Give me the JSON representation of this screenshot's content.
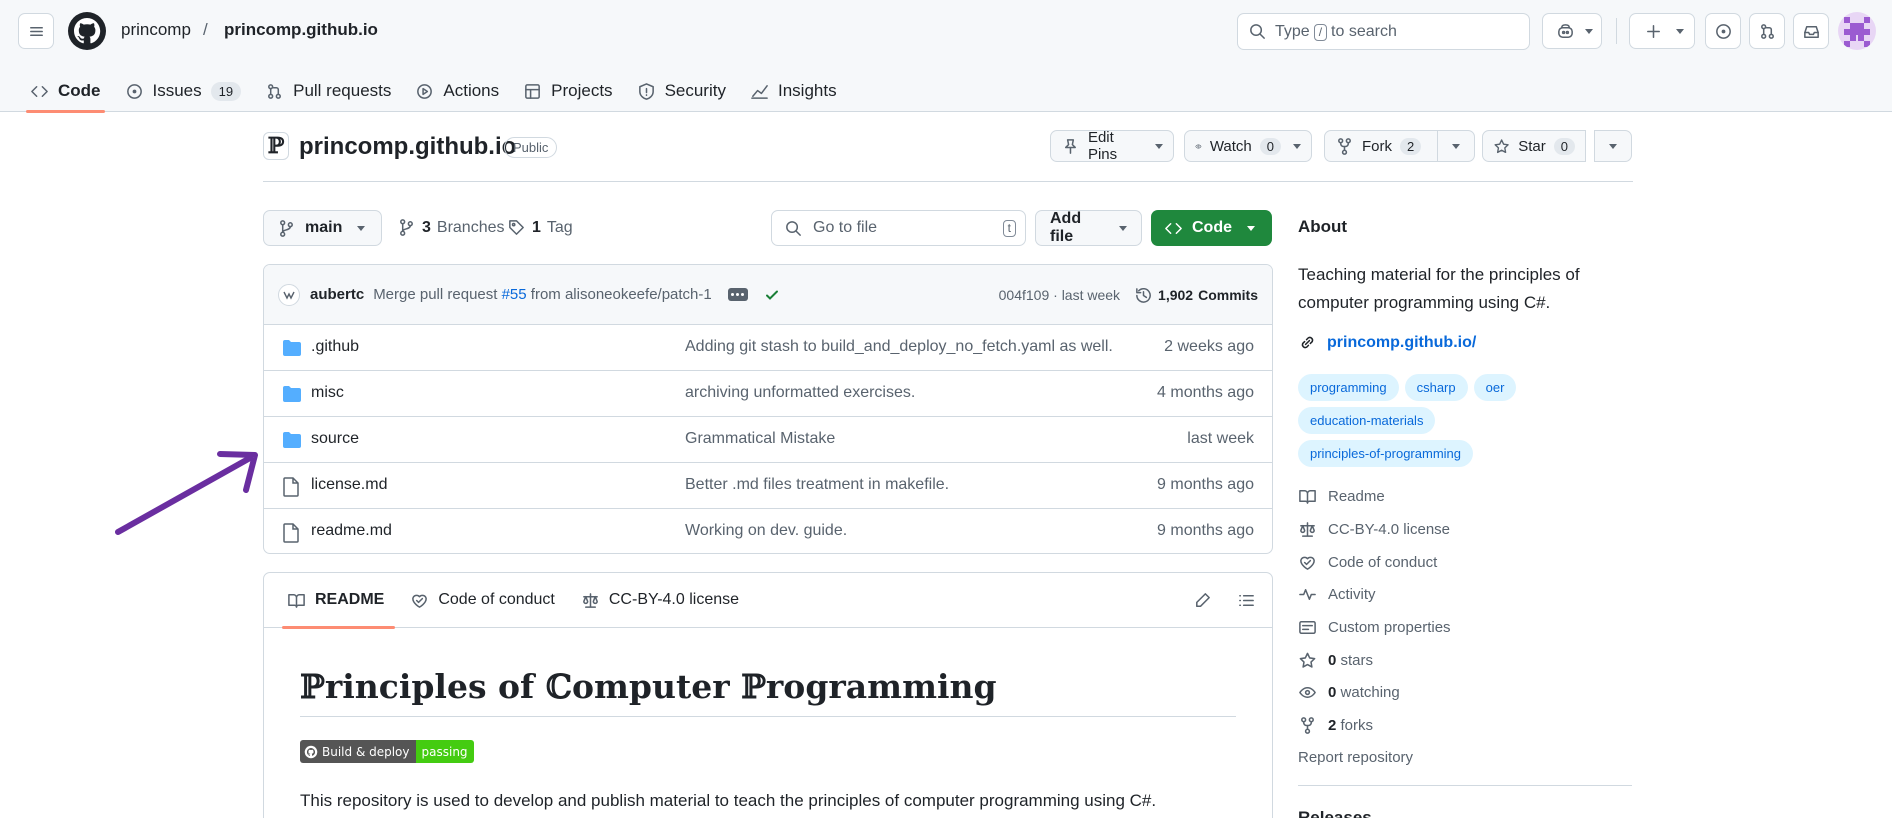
{
  "header": {
    "owner": "princomp",
    "separator": "/",
    "repo": "princomp.github.io",
    "search_prefix": "Type",
    "search_key": "/",
    "search_suffix": "to search"
  },
  "tabs": [
    {
      "label": "Code",
      "icon": "code-icon"
    },
    {
      "label": "Issues",
      "icon": "issue-icon",
      "count": "19"
    },
    {
      "label": "Pull requests",
      "icon": "pull-request-icon"
    },
    {
      "label": "Actions",
      "icon": "play-icon"
    },
    {
      "label": "Projects",
      "icon": "table-icon"
    },
    {
      "label": "Security",
      "icon": "shield-icon"
    },
    {
      "label": "Insights",
      "icon": "graph-icon"
    }
  ],
  "repo": {
    "icon_glyph": "ℙ",
    "name": "princomp.github.io",
    "visibility": "Public",
    "edit_pins": "Edit Pins",
    "watch": "Watch",
    "watch_count": "0",
    "fork": "Fork",
    "fork_count": "2",
    "star": "Star",
    "star_count": "0"
  },
  "filenav": {
    "branch": "main",
    "branches_count": "3",
    "branches_label": "Branches",
    "tags_count": "1",
    "tags_label": "Tag",
    "goto_placeholder": "Go to file",
    "goto_key": "t",
    "add_file": "Add file",
    "code": "Code"
  },
  "commit": {
    "author": "aubertc",
    "message_prefix": "Merge pull request",
    "pr": "#55",
    "message_suffix": "from alisoneokeefe/patch-1",
    "hash_time": "004f109 · last week",
    "commits_count": "1,902",
    "commits_label": "Commits"
  },
  "files": [
    {
      "type": "folder",
      "name": ".github",
      "message": "Adding git stash to build_and_deploy_no_fetch.yaml as well.",
      "date": "2 weeks ago"
    },
    {
      "type": "folder",
      "name": "misc",
      "message": "archiving unformatted exercises.",
      "date": "4 months ago"
    },
    {
      "type": "folder",
      "name": "source",
      "message": "Grammatical Mistake",
      "date": "last week"
    },
    {
      "type": "file",
      "name": "license.md",
      "message": "Better .md files treatment in makefile.",
      "date": "9 months ago"
    },
    {
      "type": "file",
      "name": "readme.md",
      "message": "Working on dev. guide.",
      "date": "9 months ago"
    }
  ],
  "readme": {
    "tabs": [
      "README",
      "Code of conduct",
      "CC-BY-4.0 license"
    ],
    "title": "ℙrinciples of ℂomputer ℙrogramming",
    "badge_left": "Build & deploy",
    "badge_right": "passing",
    "paragraph": "This repository is used to develop and publish material to teach the principles of computer programming using C#."
  },
  "about": {
    "heading": "About",
    "description": "Teaching material for the principles of computer programming using C#.",
    "link": "princomp.github.io/",
    "topics": [
      "programming",
      "csharp",
      "oer",
      "education-materials",
      "principles-of-programming"
    ],
    "items": [
      {
        "icon": "book-icon",
        "label": "Readme"
      },
      {
        "icon": "law-icon",
        "label": "CC-BY-4.0 license"
      },
      {
        "icon": "code-of-conduct-icon",
        "label": "Code of conduct"
      },
      {
        "icon": "pulse-icon",
        "label": "Activity"
      },
      {
        "icon": "note-icon",
        "label": "Custom properties"
      },
      {
        "icon": "star-icon",
        "count": "0",
        "label": "stars"
      },
      {
        "icon": "eye-icon",
        "count": "0",
        "label": "watching"
      },
      {
        "icon": "fork-icon",
        "count": "2",
        "label": "forks"
      }
    ],
    "report": "Report repository",
    "releases": "Releases"
  },
  "colors": {
    "accent_underline": "#fd8c73",
    "link": "#0969da",
    "primary_button": "#1f883d",
    "folder": "#54aeff",
    "annotation_arrow": "#6a2ea0"
  }
}
